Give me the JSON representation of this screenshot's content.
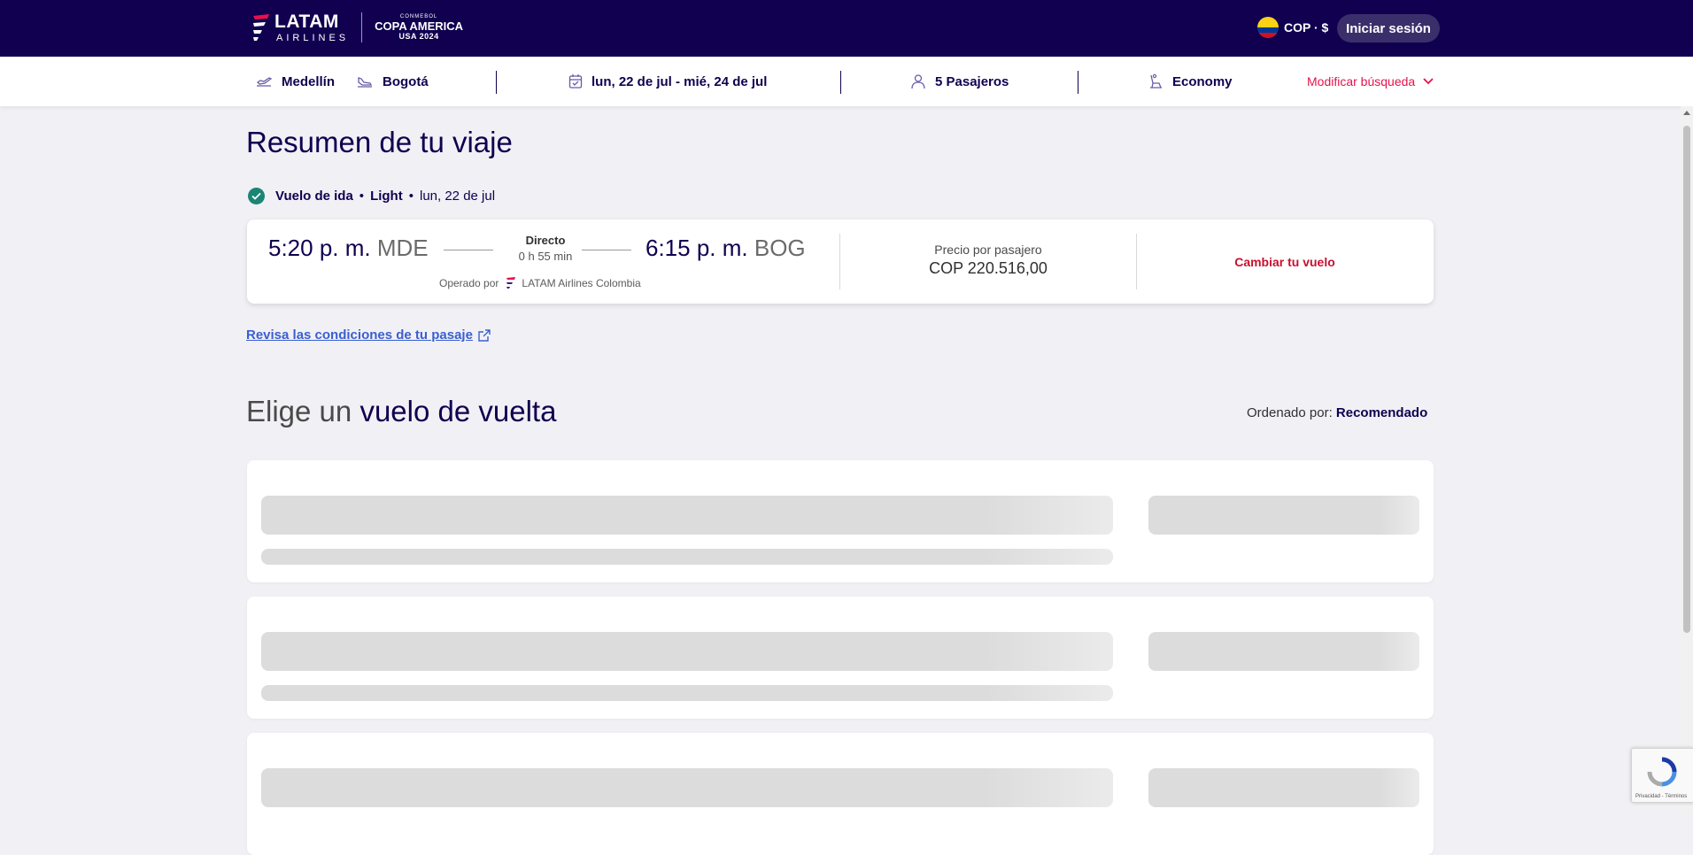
{
  "header": {
    "logo": {
      "brand": "LATAM",
      "sub": "AIRLINES",
      "partner_top": "CONMEBOL",
      "partner_main": "COPA AMERICA",
      "partner_year": "USA 2024"
    },
    "currency_label": "COP · $",
    "login_label": "Iniciar sesión"
  },
  "search_summary": {
    "origin": "Medellín",
    "destination": "Bogotá",
    "dates": "lun, 22 de jul - mié, 24 de jul",
    "passengers": "5 Pasajeros",
    "cabin": "Economy",
    "modify_label": "Modificar búsqueda"
  },
  "trip_summary": {
    "title": "Resumen de tu viaje",
    "leg_label": "Vuelo de ida",
    "fare": "Light",
    "date": "lun, 22 de jul",
    "departure_time": "5:20 p. m.",
    "departure_airport": "MDE",
    "arrival_time": "6:15 p. m.",
    "arrival_airport": "BOG",
    "stops": "Directo",
    "duration": "0 h 55 min",
    "operated_by_label": "Operado por",
    "operator": "LATAM Airlines Colombia",
    "price_label": "Precio por pasajero",
    "price": "COP 220.516,00",
    "change_label": "Cambiar tu vuelo",
    "conditions_link": "Revisa las condiciones de tu pasaje"
  },
  "return_section": {
    "title_light": "Elige un",
    "title_bold": "vuelo de vuelta",
    "sort_label": "Ordenado por:",
    "sort_value": "Recomendado"
  },
  "recaptcha_text": "Privacidad - Términos",
  "colors": {
    "header_bg": "#10004f",
    "accent": "#e8114b",
    "success": "#1a8574",
    "link": "#3a5fd0"
  }
}
